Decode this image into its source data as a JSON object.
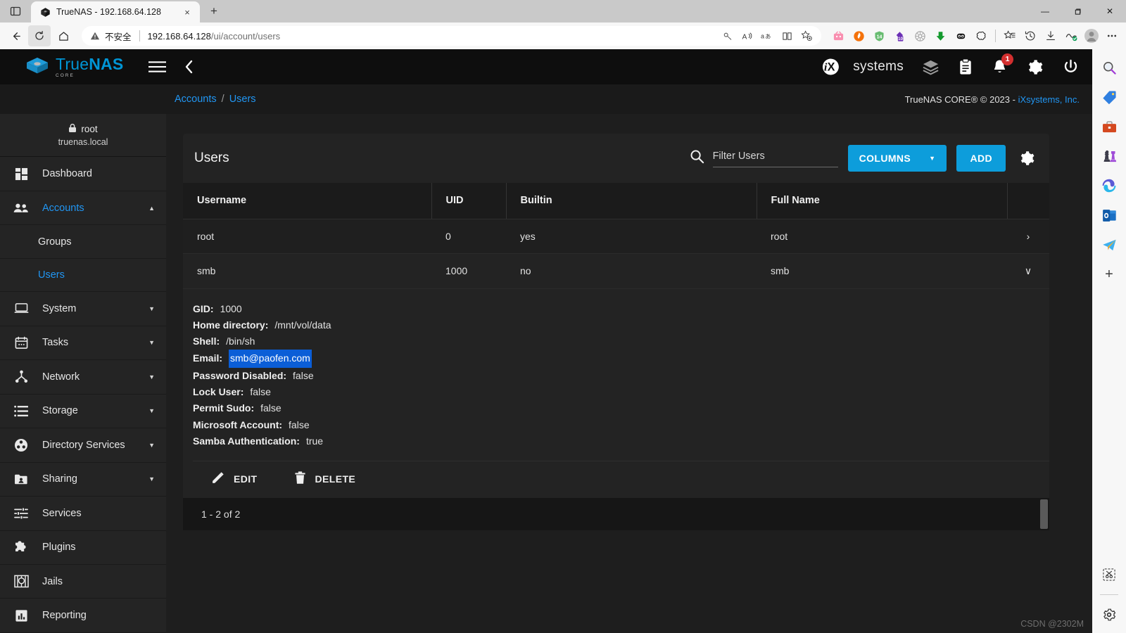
{
  "browser": {
    "tab": {
      "title": "TrueNAS - 192.168.64.128",
      "favicon": "truenas-favicon",
      "close": "×"
    },
    "newtab_label": "+",
    "window_controls": {
      "minimize": "—",
      "maximize": "❐",
      "close": "✕"
    },
    "nav": {
      "back": "←",
      "reload": "↻",
      "home": "⌂"
    },
    "omnibox": {
      "security_label": "不安全",
      "url_host": "192.168.64.128",
      "url_path": "/ui/account/users"
    },
    "omnibox_icons": [
      "key-icon",
      "read-aloud-icon",
      "translate-icon",
      "split-screen-icon",
      "add-favorite-icon"
    ],
    "extension_icons": [
      "pink-tv-icon",
      "firefox-like-icon",
      "adguard-icon",
      "purple-badge-icon",
      "wheel-icon",
      "download-green-icon",
      "panda-icon",
      "puzzle-cloud-icon"
    ],
    "toolbar_icons": [
      "collections-icon",
      "history-icon",
      "downloads-icon",
      "browser-essentials-icon",
      "profile-avatar-icon"
    ],
    "settings_icon": "ellipsis-icon"
  },
  "edgebar": {
    "icons": [
      "search-icon",
      "shopping-tag-icon",
      "tools-briefcase-icon",
      "games-icon",
      "copilot-icon",
      "outlook-icon",
      "telegram-icon"
    ],
    "add_label": "+",
    "bottom_icons": [
      "split-scissors-icon",
      "settings-gear-icon"
    ]
  },
  "topbar": {
    "brand_primary": "True",
    "brand_secondary": "NAS",
    "brand_sub": "CORE",
    "menu_icon": "hamburger-menu-icon",
    "collapse_icon": "chevron-left-icon",
    "ix_text": "systems",
    "icons": {
      "jobs": "layers-icon",
      "tasks": "clipboard-icon",
      "alerts": "bell-icon",
      "alerts_count": "1",
      "settings": "gear-icon",
      "power": "power-icon"
    }
  },
  "breadcrumb": {
    "items": [
      "Accounts",
      "Users"
    ],
    "separator": "/"
  },
  "copyright": {
    "text": "TrueNAS CORE® © 2023 - ",
    "link": "iXsystems, Inc."
  },
  "sidebar": {
    "user": {
      "name": "root",
      "host": "truenas.local",
      "lock_icon": "lock-icon"
    },
    "items": [
      {
        "label": "Dashboard",
        "icon": "dashboard-icon",
        "active": false,
        "caret": ""
      },
      {
        "label": "Accounts",
        "icon": "accounts-people-icon",
        "active": true,
        "caret": "▲"
      },
      {
        "label": "Groups",
        "icon": "",
        "active": false,
        "caret": "",
        "sub": true
      },
      {
        "label": "Users",
        "icon": "",
        "active": true,
        "caret": "",
        "sub": true
      },
      {
        "label": "System",
        "icon": "system-laptop-icon",
        "active": false,
        "caret": "▼"
      },
      {
        "label": "Tasks",
        "icon": "tasks-calendar-icon",
        "active": false,
        "caret": "▼"
      },
      {
        "label": "Network",
        "icon": "network-icon",
        "active": false,
        "caret": "▼"
      },
      {
        "label": "Storage",
        "icon": "storage-list-icon",
        "active": false,
        "caret": "▼"
      },
      {
        "label": "Directory Services",
        "icon": "directory-services-icon",
        "active": false,
        "caret": "▼"
      },
      {
        "label": "Sharing",
        "icon": "sharing-folder-icon",
        "active": false,
        "caret": "▼"
      },
      {
        "label": "Services",
        "icon": "services-sliders-icon",
        "active": false,
        "caret": ""
      },
      {
        "label": "Plugins",
        "icon": "plugins-puzzle-icon",
        "active": false,
        "caret": ""
      },
      {
        "label": "Jails",
        "icon": "jails-icon",
        "active": false,
        "caret": ""
      },
      {
        "label": "Reporting",
        "icon": "reporting-chart-icon",
        "active": false,
        "caret": ""
      }
    ]
  },
  "main": {
    "title": "Users",
    "search": {
      "placeholder": "Filter Users",
      "icon": "search-icon"
    },
    "columns_button": {
      "label": "COLUMNS",
      "caret": "▼"
    },
    "add_button": {
      "label": "ADD"
    },
    "settings_icon": "gear-icon",
    "table": {
      "headers": [
        "Username",
        "UID",
        "Builtin",
        "Full Name",
        ""
      ],
      "rows": [
        {
          "username": "root",
          "uid": "0",
          "builtin": "yes",
          "fullname": "root",
          "expand": "›",
          "expanded": false
        },
        {
          "username": "smb",
          "uid": "1000",
          "builtin": "no",
          "fullname": "smb",
          "expand": "∨",
          "expanded": true
        }
      ]
    },
    "detail": {
      "fields": [
        {
          "key": "GID:",
          "value": "1000",
          "selected": false
        },
        {
          "key": "Home directory:",
          "value": "/mnt/vol/data",
          "selected": false
        },
        {
          "key": "Shell:",
          "value": "/bin/sh",
          "selected": false
        },
        {
          "key": "Email:",
          "value": "smb@paofen.com",
          "selected": true
        },
        {
          "key": "Password Disabled:",
          "value": "false",
          "selected": false
        },
        {
          "key": "Lock User:",
          "value": "false",
          "selected": false
        },
        {
          "key": "Permit Sudo:",
          "value": "false",
          "selected": false
        },
        {
          "key": "Microsoft Account:",
          "value": "false",
          "selected": false
        },
        {
          "key": "Samba Authentication:",
          "value": "true",
          "selected": false
        }
      ],
      "actions": [
        {
          "label": "EDIT",
          "icon": "pencil-icon"
        },
        {
          "label": "DELETE",
          "icon": "trash-icon"
        }
      ]
    },
    "pagination": {
      "text": "1 - 2 of 2"
    }
  },
  "watermark": {
    "text": "CSDN @2302M"
  },
  "colors": {
    "accent": "#0d9ddb",
    "link": "#2196f3",
    "selection": "#0b5ed7",
    "badge": "#d32f2f",
    "sidebar_bg": "#242424",
    "panel_bg": "#1b1b1b"
  }
}
